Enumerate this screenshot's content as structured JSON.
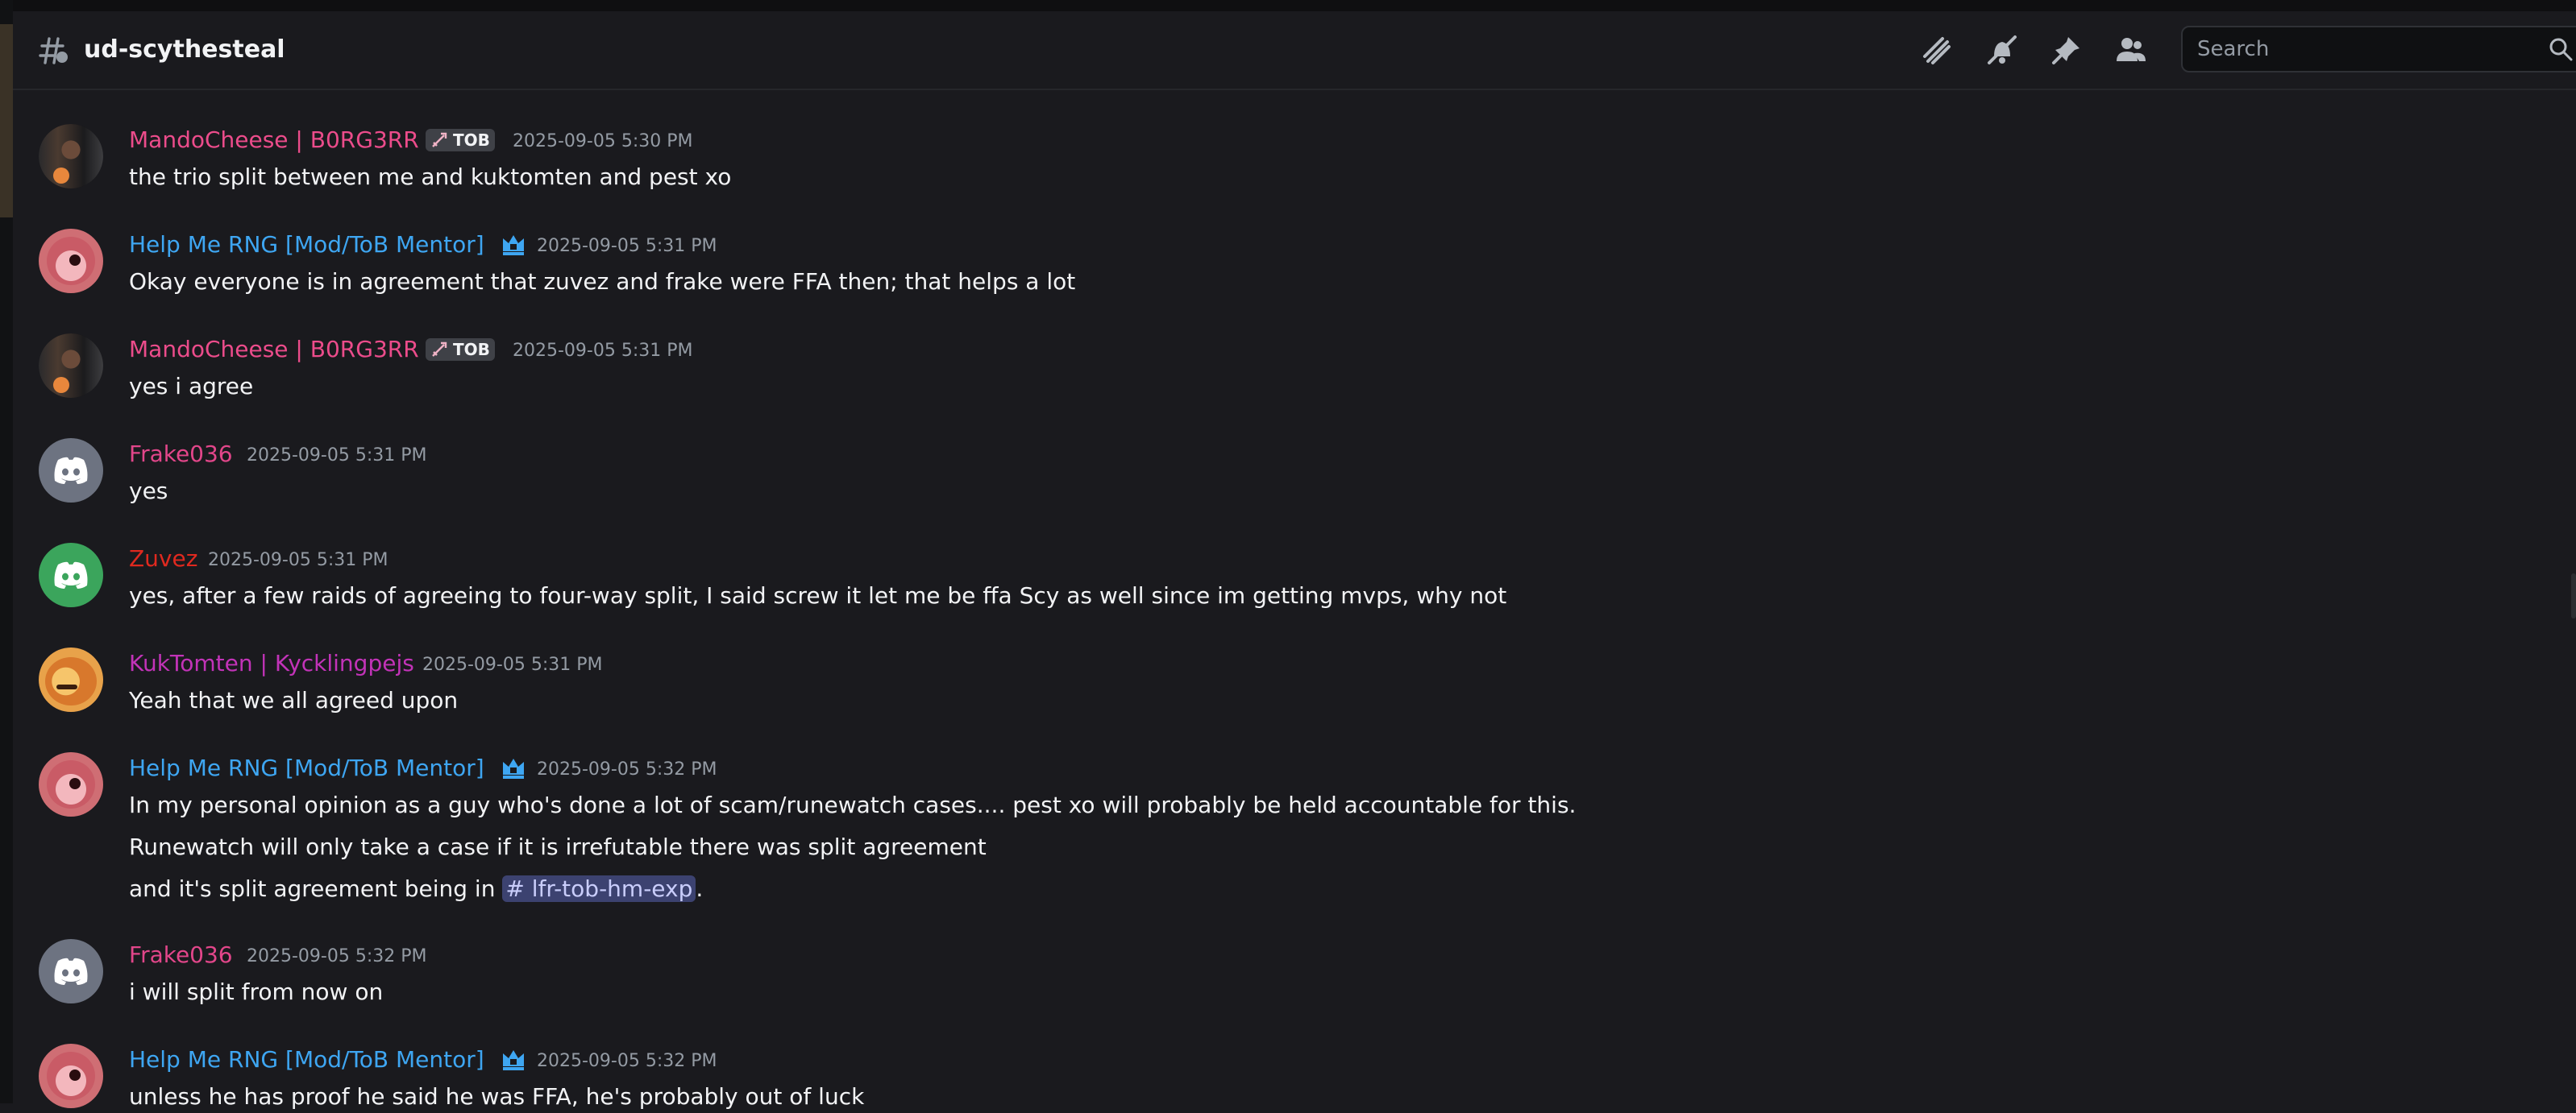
{
  "channel": {
    "name": "ud-scythesteal",
    "icon": "text-channel-thread-icon"
  },
  "toolbar": {
    "icons": [
      "threads-icon",
      "mute-bell-icon",
      "pin-icon",
      "members-icon"
    ]
  },
  "search": {
    "placeholder": "Search"
  },
  "messages": [
    {
      "author": "MandoCheese | B0RG3RR",
      "tag": "TOB",
      "time": "2025-09-05 5:30 PM",
      "lines": [
        "the trio split between me and kuktomten and pest xo"
      ]
    },
    {
      "author": "Help Me RNG [Mod/ToB Mentor]",
      "time": "2025-09-05 5:31 PM",
      "lines": [
        "Okay everyone is in agreement that zuvez and frake were FFA then; that helps a lot"
      ]
    },
    {
      "author": "MandoCheese | B0RG3RR",
      "tag": "TOB",
      "time": "2025-09-05 5:31 PM",
      "lines": [
        "yes i agree"
      ]
    },
    {
      "author": "Frake036",
      "time": "2025-09-05 5:31 PM",
      "lines": [
        "yes"
      ]
    },
    {
      "author": "Zuvez",
      "time": "2025-09-05 5:31 PM",
      "lines": [
        "yes, after a few raids of agreeing to four-way split, I said screw it let me be ffa Scy as well since im getting mvps, why not"
      ]
    },
    {
      "author": "KukTomten | Kycklingpejs",
      "time": "2025-09-05 5:31 PM",
      "lines": [
        "Yeah that we all agreed upon"
      ]
    },
    {
      "author": "Help Me RNG [Mod/ToB Mentor]",
      "time": "2025-09-05 5:32 PM",
      "lines": [
        "In my personal opinion as a guy who's done a lot of scam/runewatch cases.... pest xo will probably be held accountable for this.",
        "Runewatch will only take a case if it is irrefutable there was split agreement",
        "and it's split agreement being in"
      ],
      "mention": "# lfr-tob-hm-exp",
      "after_mention": "."
    },
    {
      "author": "Frake036",
      "time": "2025-09-05 5:32 PM",
      "lines": [
        "i will split from now on"
      ]
    },
    {
      "author": "Help Me RNG [Mod/ToB Mentor]",
      "time": "2025-09-05 5:32 PM",
      "lines": [
        "unless he has proof he said he was FFA, he's probably out of luck"
      ]
    }
  ]
}
